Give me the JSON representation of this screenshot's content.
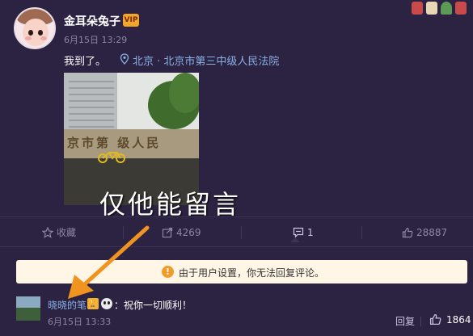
{
  "post": {
    "username": "金耳朵兔子",
    "vip_badge": "VIP",
    "time": "6月15日 13:29",
    "text": "我到了。",
    "location": "北京 · 北京市第三中级人民法院",
    "photo_sign": "京市第 级人民",
    "overlay_caption": "仅他能留言"
  },
  "actions": {
    "favorite_label": "收藏",
    "repost_count": "4269",
    "comment_count": "1",
    "like_count": "28887"
  },
  "notice": {
    "icon": "!",
    "text": "由于用户设置，你无法回复评论。"
  },
  "comment": {
    "username": "晓晓的笔",
    "text": "：祝你一切顺利！",
    "time": "6月15日 13:33",
    "reply_label": "回复",
    "like_count": "1864"
  },
  "colors": {
    "background": "#2b2341",
    "link": "#8ab0e6",
    "notice_bg": "#fff6e6",
    "notice_icon": "#f29b27",
    "arrow": "#f0941f"
  },
  "icons": {
    "favorite": "star-icon",
    "repost": "share-icon",
    "comment": "comment-icon",
    "like": "thumb-up-icon",
    "location": "location-pin-icon"
  }
}
